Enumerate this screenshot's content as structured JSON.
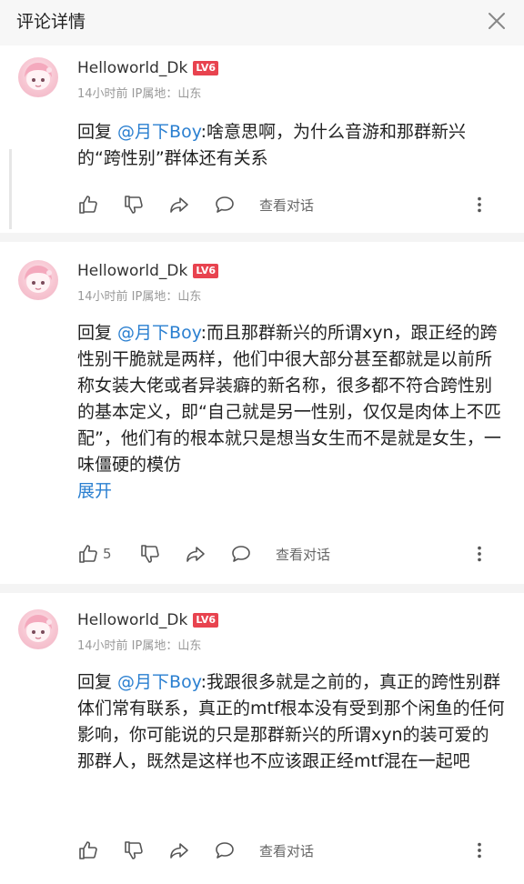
{
  "header": {
    "title": "评论详情",
    "close_icon": "close-icon"
  },
  "comments": [
    {
      "username": "Helloworld_Dk",
      "level": "LV6",
      "meta": "14小时前  IP属地：山东",
      "reply_prefix": "回复 ",
      "reply_to": "@月下Boy",
      "text": ":啥意思啊，为什么音游和那群新兴的“跨性别”群体还有关系",
      "expand": "",
      "like_count": "",
      "view_dialog": "查看对话"
    },
    {
      "username": "Helloworld_Dk",
      "level": "LV6",
      "meta": "14小时前  IP属地：山东",
      "reply_prefix": "回复 ",
      "reply_to": "@月下Boy",
      "text": ":而且那群新兴的所谓xyn，跟正经的跨性别干脆就是两样，他们中很大部分甚至都就是以前所称女装大佬或者异装癖的新名称，很多都不符合跨性别的基本定义，即“自己就是另一性别，仅仅是肉体上不匹配”，他们有的根本就只是想当女生而不是就是女生，一味僵硬的模仿",
      "expand": "展开",
      "like_count": "5",
      "view_dialog": "查看对话"
    },
    {
      "username": "Helloworld_Dk",
      "level": "LV6",
      "meta": "14小时前  IP属地：山东",
      "reply_prefix": "回复 ",
      "reply_to": "@月下Boy",
      "text": ":我跟很多就是之前的，真正的跨性别群体们常有联系，真正的mtf根本没有受到那个闲鱼的任何影响，你可能说的只是那群新兴的所谓xyn的装可爱的那群人，既然是这样也不应该跟正经mtf混在一起吧",
      "expand": "",
      "like_count": "",
      "view_dialog": "查看对话"
    }
  ],
  "colors": {
    "link": "#2a7fd0",
    "level_badge": "#e8434f",
    "meta": "#999999"
  }
}
